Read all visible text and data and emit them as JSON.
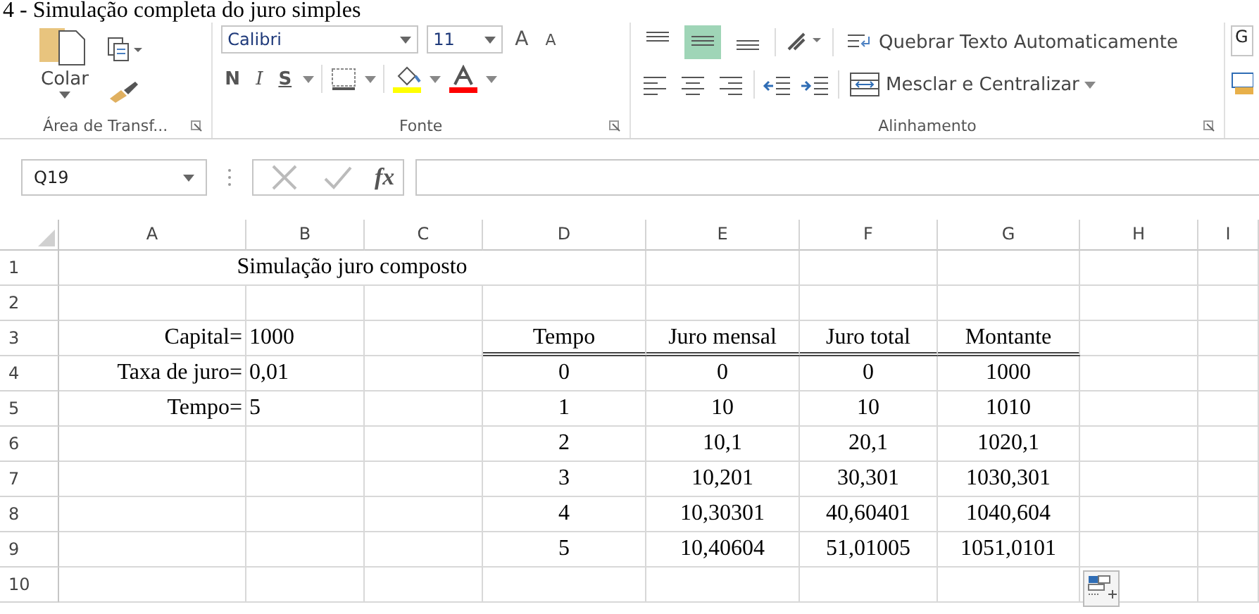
{
  "caption": "4 - Simulação completa do juro simples",
  "ribbon": {
    "clipboard": {
      "paste": "Colar",
      "label": "Área de Transf..."
    },
    "font": {
      "name": "Calibri",
      "size": "11",
      "grow": "A",
      "shrink": "A",
      "bold": "N",
      "italic": "I",
      "underline": "S",
      "label": "Fonte"
    },
    "alignment": {
      "vertical": [
        {
          "kind": "top",
          "selected": false
        },
        {
          "kind": "middle",
          "selected": true
        },
        {
          "kind": "bottom",
          "selected": false
        }
      ],
      "wrap": "Quebrar Texto Automaticamente",
      "merge": "Mesclar e Centralizar",
      "label": "Alinhamento"
    },
    "number": {
      "format": "G"
    }
  },
  "name_box": "Q19",
  "fx": "fx",
  "columns": [
    "A",
    "B",
    "C",
    "D",
    "E",
    "F",
    "G",
    "H",
    "I"
  ],
  "rows": [
    {
      "number": "1",
      "cells": [
        {
          "kind": "title",
          "text": "Simulação juro composto"
        },
        {},
        {},
        {},
        {},
        {}
      ]
    },
    {
      "number": "2",
      "cells": [
        {},
        {},
        {},
        {},
        {},
        {},
        {},
        {},
        {}
      ]
    },
    {
      "number": "3",
      "cells": [
        {
          "kind": "label",
          "text": "Capital="
        },
        {
          "kind": "value",
          "text": "1000"
        },
        {},
        {
          "kind": "number",
          "text": "Tempo",
          "double_bottom": true
        },
        {
          "kind": "number",
          "text": "Juro mensal",
          "double_bottom": true
        },
        {
          "kind": "number",
          "text": "Juro total",
          "double_bottom": true
        },
        {
          "kind": "number",
          "text": "Montante",
          "double_bottom": true
        },
        {},
        {}
      ]
    },
    {
      "number": "4",
      "cells": [
        {
          "kind": "label",
          "text": "Taxa de juro="
        },
        {
          "kind": "value",
          "text": "0,01"
        },
        {},
        {
          "kind": "number",
          "text": "0"
        },
        {
          "kind": "number",
          "text": "0"
        },
        {
          "kind": "number",
          "text": "0"
        },
        {
          "kind": "number",
          "text": "1000"
        },
        {},
        {}
      ]
    },
    {
      "number": "5",
      "cells": [
        {
          "kind": "label",
          "text": "Tempo="
        },
        {
          "kind": "value",
          "text": "5"
        },
        {},
        {
          "kind": "number",
          "text": "1"
        },
        {
          "kind": "number",
          "text": "10"
        },
        {
          "kind": "number",
          "text": "10"
        },
        {
          "kind": "number",
          "text": "1010"
        },
        {},
        {}
      ]
    },
    {
      "number": "6",
      "cells": [
        {},
        {},
        {},
        {
          "kind": "number",
          "text": "2"
        },
        {
          "kind": "number",
          "text": "10,1"
        },
        {
          "kind": "number",
          "text": "20,1"
        },
        {
          "kind": "number",
          "text": "1020,1"
        },
        {},
        {}
      ]
    },
    {
      "number": "7",
      "cells": [
        {},
        {},
        {},
        {
          "kind": "number",
          "text": "3"
        },
        {
          "kind": "number",
          "text": "10,201"
        },
        {
          "kind": "number",
          "text": "30,301"
        },
        {
          "kind": "number",
          "text": "1030,301"
        },
        {},
        {}
      ]
    },
    {
      "number": "8",
      "cells": [
        {},
        {},
        {},
        {
          "kind": "number",
          "text": "4"
        },
        {
          "kind": "number",
          "text": "10,30301"
        },
        {
          "kind": "number",
          "text": "40,60401"
        },
        {
          "kind": "number",
          "text": "1040,604"
        },
        {},
        {}
      ]
    },
    {
      "number": "9",
      "cells": [
        {},
        {},
        {},
        {
          "kind": "number",
          "text": "5"
        },
        {
          "kind": "number",
          "text": "10,40604"
        },
        {
          "kind": "number",
          "text": "51,01005"
        },
        {
          "kind": "number",
          "text": "1051,0101"
        },
        {},
        {}
      ]
    },
    {
      "number": "10",
      "cells": [
        {},
        {},
        {},
        {},
        {},
        {},
        {},
        {
          "kind": "paste_options"
        },
        {}
      ]
    }
  ]
}
